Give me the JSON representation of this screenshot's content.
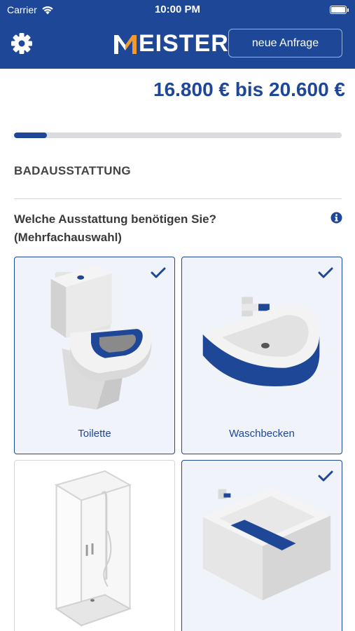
{
  "status_bar": {
    "carrier": "Carrier",
    "time": "10:00 PM"
  },
  "header": {
    "logo_text": "EISTER",
    "new_request_label": "neue Anfrage"
  },
  "price": {
    "range": "16.800 € bis 20.600 €"
  },
  "progress": {
    "fraction": 0.1
  },
  "section": {
    "title": "BADAUSSTATTUNG"
  },
  "question": {
    "text": "Welche Ausstattung benötigen Sie? (Mehrfachauswahl)"
  },
  "options": [
    {
      "label": "Toilette",
      "selected": true,
      "icon": "toilet-icon"
    },
    {
      "label": "Waschbecken",
      "selected": true,
      "icon": "washbasin-icon"
    },
    {
      "label": "",
      "selected": false,
      "icon": "shower-icon"
    },
    {
      "label": "",
      "selected": true,
      "icon": "bathtub-icon"
    }
  ],
  "colors": {
    "brand": "#1E4797",
    "card_selected_bg": "#F1F3FA",
    "progress_track": "#DADCE0"
  }
}
